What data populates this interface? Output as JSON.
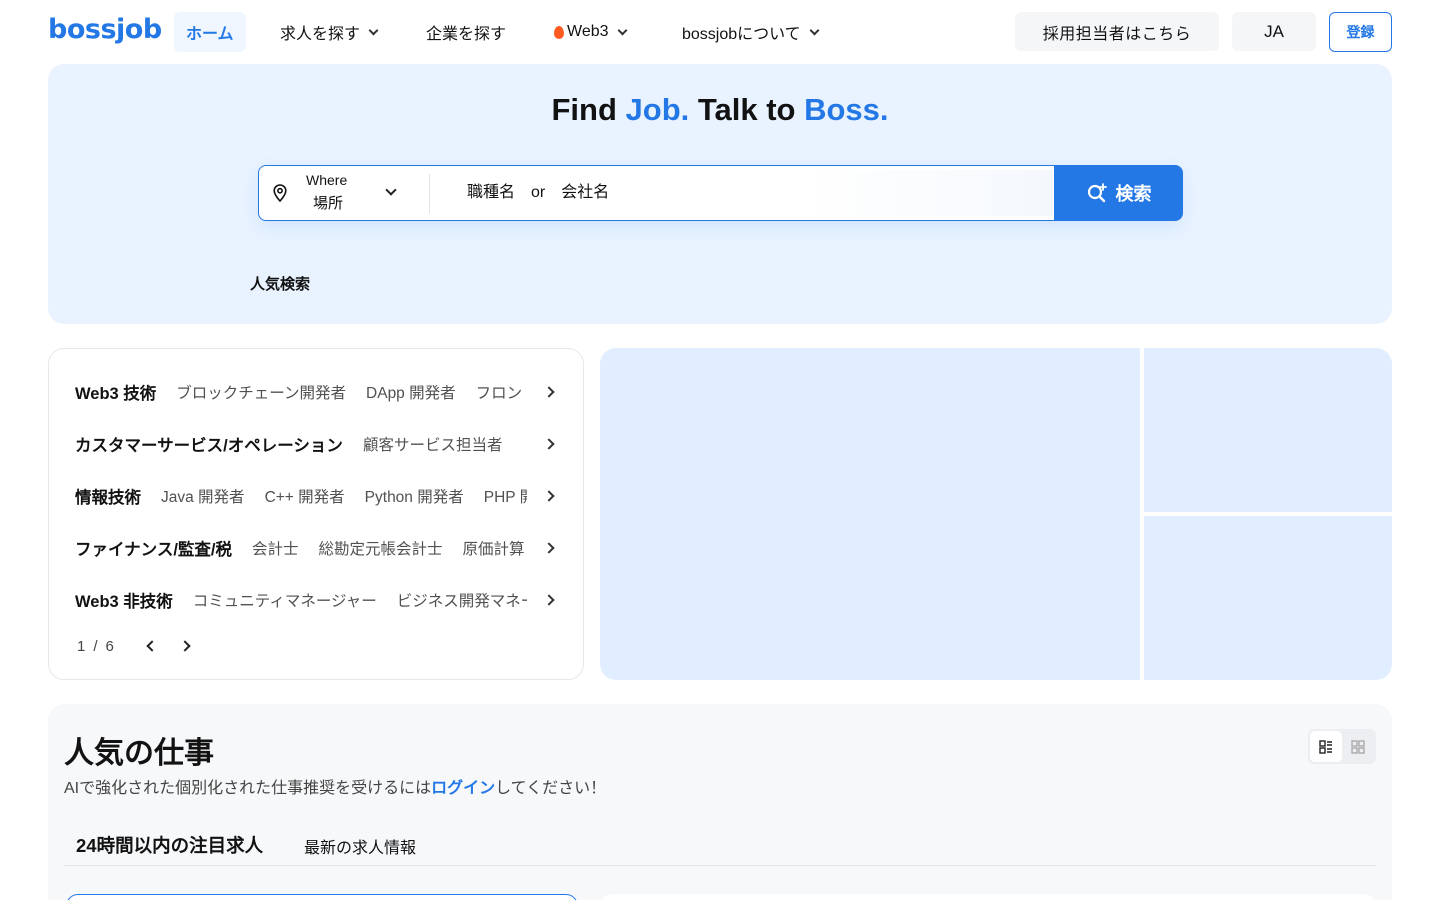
{
  "header": {
    "logo": "bossjob",
    "nav": [
      {
        "label": "ホーム",
        "active": true
      },
      {
        "label": "求人を探す",
        "has_dropdown": true
      },
      {
        "label": "企業を探す"
      },
      {
        "label": "Web3",
        "has_dropdown": true
      },
      {
        "label": "bossjobについて",
        "has_dropdown": true
      }
    ],
    "recruiter_button": "採用担当者はこちら",
    "language": "JA",
    "register_button": "登録"
  },
  "hero": {
    "title_parts": [
      "Find ",
      "Job.",
      " Talk to ",
      "Boss."
    ],
    "location_label_en": "Where",
    "location_label_ja": "場所",
    "search_placeholder": "職種名　or　会社名",
    "search_button": "検索",
    "popular_searches_label": "人気検索"
  },
  "categories": {
    "rows": [
      {
        "name": "Web3 技術",
        "subs": [
          "ブロックチェーン開発者",
          "DApp 開発者",
          "フロントエンド開発者"
        ]
      },
      {
        "name": "カスタマーサービス/オペレーション",
        "subs": [
          "顧客サービス担当者"
        ]
      },
      {
        "name": "情報技術",
        "subs": [
          "Java 開発者",
          "C++ 開発者",
          "Python 開発者",
          "PHP 開発者"
        ]
      },
      {
        "name": "ファイナンス/監査/税",
        "subs": [
          "会計士",
          "総勘定元帳会計士",
          "原価計算"
        ]
      },
      {
        "name": "Web3 非技術",
        "subs": [
          "コミュニティマネージャー",
          "ビジネス開発マネージャー"
        ]
      }
    ],
    "pager": {
      "current": "1",
      "separator": "/",
      "total": "6"
    }
  },
  "popular_jobs": {
    "title": "人気の仕事",
    "subtitle_before": "AIで強化された個別化された仕事推奨を受けるには",
    "subtitle_link": "ログイン",
    "subtitle_after": "してください！",
    "tabs": [
      "24時間以内の注目求人",
      "最新の求人情報"
    ]
  },
  "colors": {
    "brand": "#2378e5",
    "hero_bg": "#e9f3ff",
    "banner_bg": "#e1eeff"
  }
}
